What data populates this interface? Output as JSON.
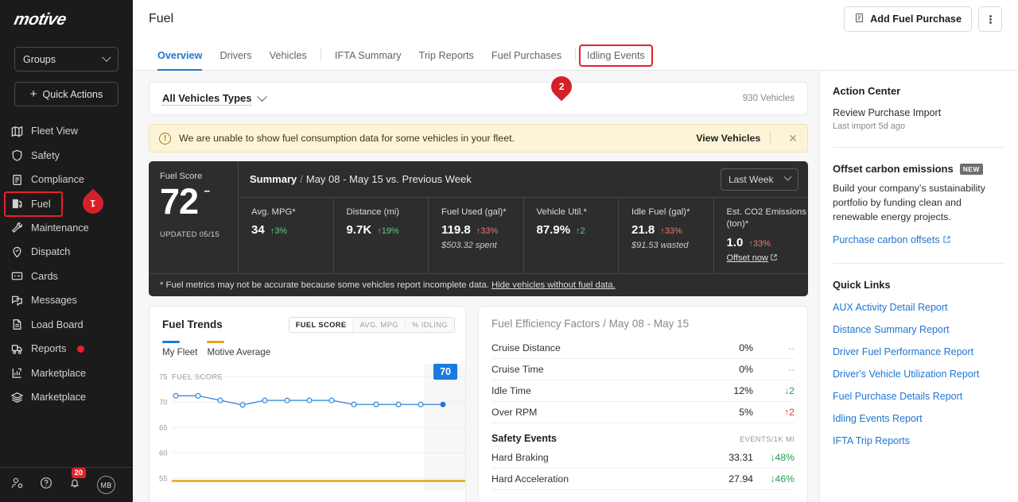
{
  "sidebar": {
    "logo": "motive",
    "groups_label": "Groups",
    "quick_actions_label": "Quick Actions",
    "items": [
      {
        "label": "Fleet View",
        "icon": "map-icon"
      },
      {
        "label": "Safety",
        "icon": "shield-icon"
      },
      {
        "label": "Compliance",
        "icon": "clipboard-icon"
      },
      {
        "label": "Fuel",
        "icon": "fuel-pump-icon"
      },
      {
        "label": "Maintenance",
        "icon": "wrench-icon"
      },
      {
        "label": "Dispatch",
        "icon": "pin-icon"
      },
      {
        "label": "Cards",
        "icon": "card-icon"
      },
      {
        "label": "Messages",
        "icon": "chat-icon"
      },
      {
        "label": "Load Board",
        "icon": "truck-icon"
      },
      {
        "label": "Reports",
        "icon": "chart-icon"
      },
      {
        "label": "Marketplace",
        "icon": "layers-icon"
      }
    ],
    "notification_count": "20",
    "avatar_initials": "MB"
  },
  "header": {
    "title": "Fuel",
    "add_fuel_purchase": "Add Fuel Purchase"
  },
  "tabs": [
    {
      "label": "Overview",
      "active": true
    },
    {
      "label": "Drivers",
      "active": false
    },
    {
      "label": "Vehicles",
      "active": false
    },
    {
      "label": "IFTA Summary",
      "active": false
    },
    {
      "label": "Trip Reports",
      "active": false
    },
    {
      "label": "Fuel Purchases",
      "active": false
    },
    {
      "label": "Idling Events",
      "active": false
    }
  ],
  "filter": {
    "label": "All Vehicles Types",
    "vehicle_count": "930 Vehicles"
  },
  "alert": {
    "text": "We are unable to show fuel consumption data for some vehicles in your fleet.",
    "action": "View Vehicles",
    "close": "✕"
  },
  "summary": {
    "score_label": "Fuel Score",
    "score_value": "72",
    "score_sup": "--",
    "updated": "UPDATED 05/15",
    "title": "Summary",
    "range": "May 08 - May 15 vs. Previous Week",
    "week_selector": "Last Week",
    "metrics": [
      {
        "label": "Avg. MPG*",
        "value": "34",
        "delta": "↑3%",
        "delta_dir": "up-green",
        "sub": ""
      },
      {
        "label": "Distance (mi)",
        "value": "9.7K",
        "delta": "↑19%",
        "delta_dir": "up-green",
        "sub": ""
      },
      {
        "label": "Fuel Used (gal)*",
        "value": "119.8",
        "delta": "↑33%",
        "delta_dir": "up-red",
        "sub": "$503.32 spent"
      },
      {
        "label": "Vehicle Util.*",
        "value": "87.9%",
        "delta": "↑2",
        "delta_dir": "up-green",
        "sub": ""
      },
      {
        "label": "Idle Fuel (gal)*",
        "value": "21.8",
        "delta": "↑33%",
        "delta_dir": "up-red",
        "sub": "$91.53 wasted"
      },
      {
        "label": "Est. CO2 Emissions (ton)*",
        "value": "1.0",
        "delta": "↑33%",
        "delta_dir": "up-red",
        "sub": "",
        "link": "Offset now"
      }
    ],
    "footnote_text": "* Fuel metrics may not be accurate because some vehicles report incomplete data.",
    "footnote_link": "Hide vehicles without fuel data."
  },
  "trends": {
    "title": "Fuel Trends",
    "segments": [
      "FUEL SCORE",
      "AVG. MPG",
      "% IDLING"
    ],
    "active_segment": "FUEL SCORE",
    "legend": [
      {
        "label": "My Fleet",
        "color": "#1a7ae0"
      },
      {
        "label": "Motive Average",
        "color": "#e8a31d"
      }
    ],
    "current_chip": "70"
  },
  "chart_data": {
    "type": "line",
    "title": "Fuel Trends",
    "ylabel": "FUEL SCORE",
    "axis_top_label": "75 FUEL SCORE",
    "ytick_labels": [
      "75",
      "70",
      "65",
      "60",
      "55"
    ],
    "ylim": [
      52,
      77
    ],
    "grid": true,
    "legend_position": "top-left",
    "x": [
      1,
      2,
      3,
      4,
      5,
      6,
      7,
      8,
      9,
      10,
      11,
      12,
      13
    ],
    "series": [
      {
        "name": "My Fleet",
        "color": "#1a7ae0",
        "values": [
          71.2,
          71.2,
          70.3,
          69.4,
          70.3,
          70.3,
          70.3,
          70.3,
          69.5,
          69.5,
          69.5,
          69.5,
          69.5
        ]
      },
      {
        "name": "Motive Average",
        "color": "#e8a31d",
        "values": [
          54.6,
          54.6,
          54.6,
          54.6,
          54.6,
          54.6,
          54.6,
          54.6,
          54.6,
          54.6,
          54.6,
          54.6,
          54.6
        ]
      }
    ]
  },
  "factors": {
    "title": "Fuel Efficiency Factors",
    "subtitle": "/ May 08 - May 15",
    "rows": [
      {
        "name": "Cruise Distance",
        "value": "0%",
        "delta": "--",
        "delta_dir": "n"
      },
      {
        "name": "Cruise Time",
        "value": "0%",
        "delta": "--",
        "delta_dir": "n"
      },
      {
        "name": "Idle Time",
        "value": "12%",
        "delta": "↓2",
        "delta_dir": "g"
      },
      {
        "name": "Over RPM",
        "value": "5%",
        "delta": "↑2",
        "delta_dir": "r"
      }
    ],
    "safety_title": "Safety Events",
    "safety_unit": "EVENTS/1K MI",
    "safety_rows": [
      {
        "name": "Hard Braking",
        "value": "33.31",
        "delta": "↓48%",
        "delta_dir": "g"
      },
      {
        "name": "Hard Acceleration",
        "value": "27.94",
        "delta": "↓46%",
        "delta_dir": "g"
      }
    ]
  },
  "right": {
    "action_center_title": "Action Center",
    "action_item": "Review Purchase Import",
    "action_sub": "Last import 5d ago",
    "offset_title": "Offset carbon emissions",
    "offset_badge": "NEW",
    "offset_body": "Build your company’s sustainability portfolio by funding clean and renewable energy projects.",
    "offset_link": "Purchase carbon offsets",
    "quick_links_title": "Quick Links",
    "quick_links": [
      "AUX Activity Detail Report",
      "Distance Summary Report",
      "Driver Fuel Performance Report",
      "Driver's Vehicle Utilization Report",
      "Fuel Purchase Details Report",
      "Idling Events Report",
      "IFTA Trip Reports"
    ]
  },
  "markers": [
    {
      "number": "1"
    },
    {
      "number": "2"
    }
  ]
}
